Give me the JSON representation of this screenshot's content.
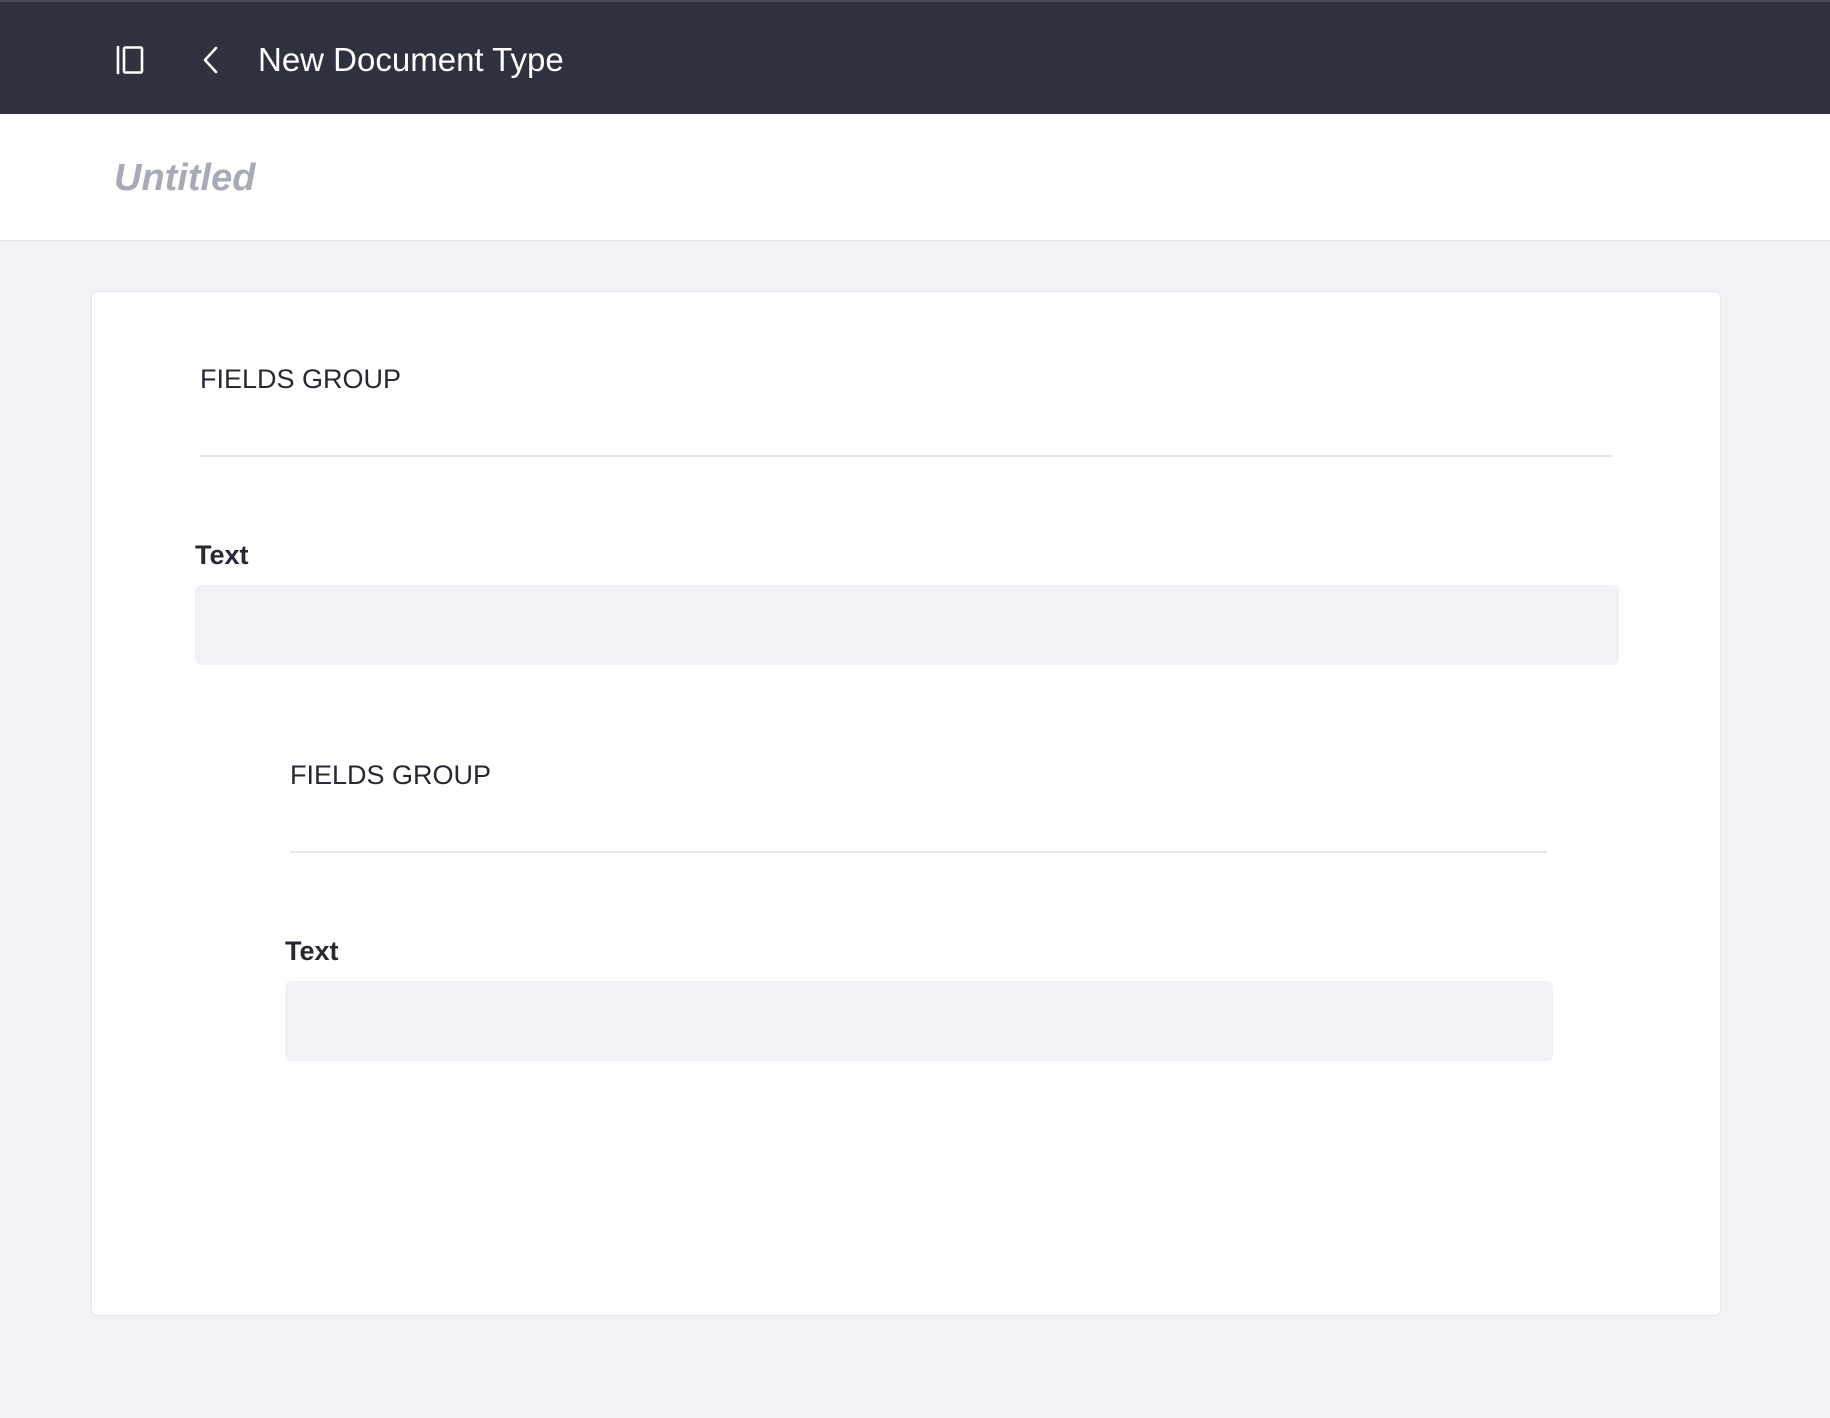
{
  "header": {
    "title": "New Document Type",
    "icons": {
      "panel_toggle": "sidebar-panel-icon",
      "back": "chevron-left-icon"
    },
    "background_color": "#30313f"
  },
  "title_bar": {
    "placeholder": "Untitled",
    "value": ""
  },
  "form": {
    "groups": [
      {
        "title": "FIELDS GROUP",
        "fields": [
          {
            "label": "Text",
            "value": ""
          }
        ]
      },
      {
        "title": "FIELDS GROUP",
        "fields": [
          {
            "label": "Text",
            "value": ""
          }
        ]
      }
    ]
  },
  "colors": {
    "page_background": "#f1f2f5",
    "text_primary": "#272833",
    "placeholder": "#a8aab7",
    "input_background": "#f1f2f5"
  }
}
